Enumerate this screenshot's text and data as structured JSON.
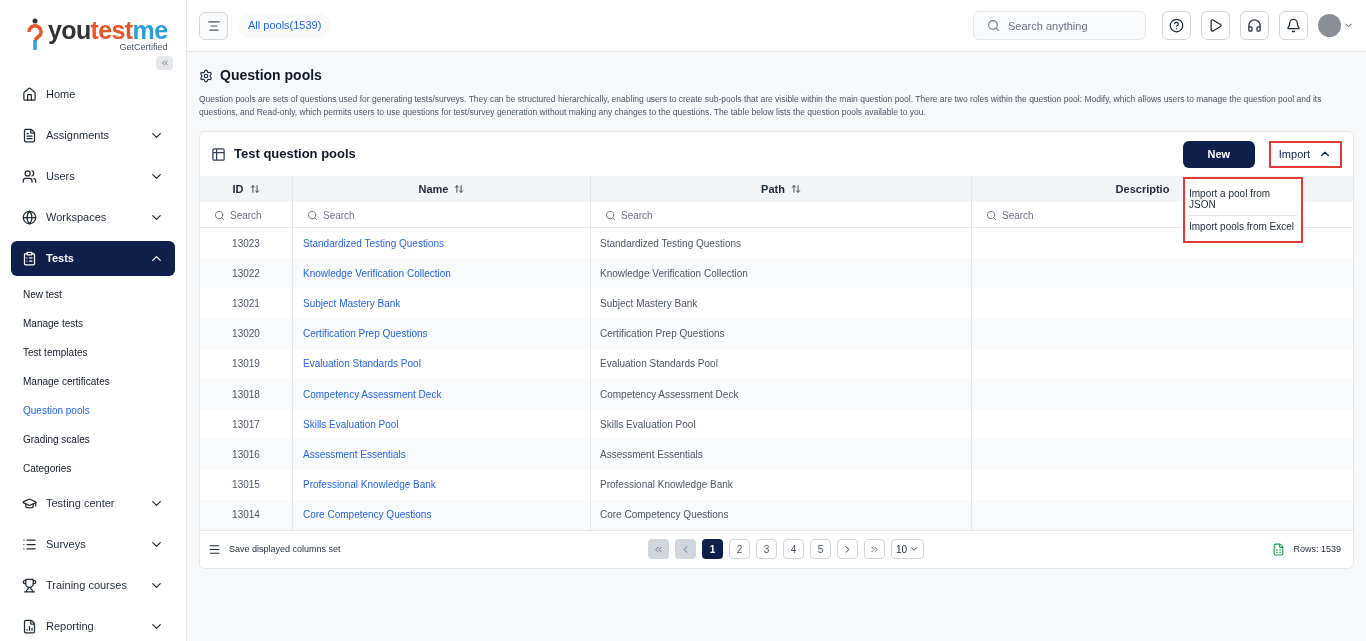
{
  "logo": {
    "parts": [
      "you",
      "test",
      "me"
    ],
    "tagline": "GetCertified"
  },
  "sidebar": {
    "items": [
      {
        "label": "Home",
        "kind": "link",
        "selected": false
      },
      {
        "label": "Assignments",
        "kind": "group",
        "expanded": false,
        "selected": false
      },
      {
        "label": "Users",
        "kind": "group",
        "expanded": false,
        "selected": false
      },
      {
        "label": "Workspaces",
        "kind": "group",
        "expanded": false,
        "selected": false
      },
      {
        "label": "Tests",
        "kind": "group",
        "expanded": true,
        "selected": true,
        "children": [
          {
            "label": "New test",
            "selected": false
          },
          {
            "label": "Manage tests",
            "selected": false
          },
          {
            "label": "Test templates",
            "selected": false
          },
          {
            "label": "Manage certificates",
            "selected": false
          },
          {
            "label": "Question pools",
            "selected": true
          },
          {
            "label": "Grading scales",
            "selected": false
          },
          {
            "label": "Categories",
            "selected": false
          }
        ]
      },
      {
        "label": "Testing center",
        "kind": "group",
        "expanded": false,
        "selected": false
      },
      {
        "label": "Surveys",
        "kind": "group",
        "expanded": false,
        "selected": false
      },
      {
        "label": "Training courses",
        "kind": "group",
        "expanded": false,
        "selected": false
      },
      {
        "label": "Reporting",
        "kind": "group",
        "expanded": false,
        "selected": false
      }
    ]
  },
  "topbar": {
    "breadcrumb": "All pools(1539)",
    "search": {
      "placeholder": "Search anything"
    }
  },
  "page": {
    "title": "Question pools",
    "description": "Question pools are sets of questions used for generating tests/surveys. They can be structured hierarchically, enabling users to create sub-pools that are visible within the main question pool. There are two roles within the question pool: Modify, which allows users to manage the question pool and its questions, and Read-only, which permits users to use questions for test/survey generation without making any changes to the questions. The table below lists the question pools available to you."
  },
  "table": {
    "title": "Test question pools",
    "new_button": "New",
    "import_button": {
      "label": "Import",
      "expanded": true
    },
    "import_menu": [
      "Import a pool from JSON",
      "Import pools from Excel"
    ],
    "columns": [
      {
        "label": "ID",
        "sortable": true
      },
      {
        "label": "Name",
        "sortable": true
      },
      {
        "label": "Path",
        "sortable": true
      },
      {
        "label": "Descriptio",
        "sortable": false
      }
    ],
    "filter_placeholders": [
      "Search",
      "Search",
      "Search",
      "Search"
    ],
    "rows": [
      {
        "id": "13023",
        "name": "Standardized Testing Questions",
        "path": "Standardized Testing Questions"
      },
      {
        "id": "13022",
        "name": "Knowledge Verification Collection",
        "path": "Knowledge Verification Collection"
      },
      {
        "id": "13021",
        "name": "Subject Mastery Bank",
        "path": "Subject Mastery Bank"
      },
      {
        "id": "13020",
        "name": "Certification Prep Questions",
        "path": "Certification Prep Questions"
      },
      {
        "id": "13019",
        "name": "Evaluation Standards Pool",
        "path": "Evaluation Standards Pool"
      },
      {
        "id": "13018",
        "name": "Competency Assessment Deck",
        "path": "Competency Assessment Deck"
      },
      {
        "id": "13017",
        "name": "Skills Evaluation Pool",
        "path": "Skills Evaluation Pool"
      },
      {
        "id": "13016",
        "name": "Assessment Essentials",
        "path": "Assessment Essentials"
      },
      {
        "id": "13015",
        "name": "Professional Knowledge Bank",
        "path": "Professional Knowledge Bank"
      },
      {
        "id": "13014",
        "name": "Core Competency Questions",
        "path": "Core Competency Questions"
      }
    ],
    "footer": {
      "save_columns": "Save displayed columns set",
      "pages": [
        {
          "label": "1",
          "selected": true
        },
        {
          "label": "2",
          "selected": false
        },
        {
          "label": "3",
          "selected": false
        },
        {
          "label": "4",
          "selected": false
        },
        {
          "label": "5",
          "selected": false
        }
      ],
      "page_size": "10",
      "rows_count": "Rows: 1539"
    }
  }
}
